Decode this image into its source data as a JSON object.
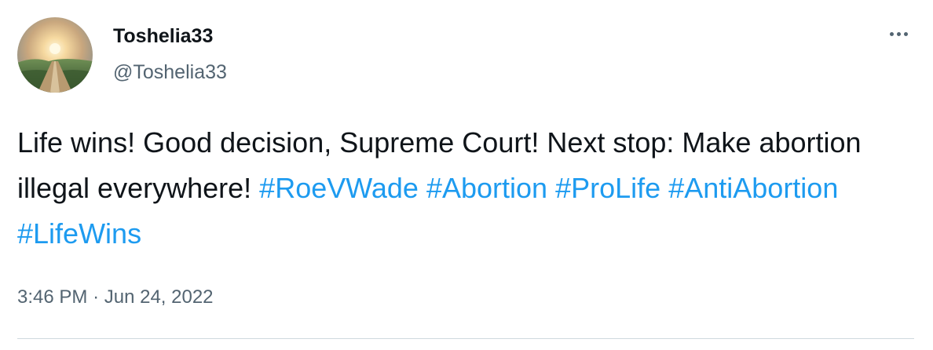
{
  "tweet": {
    "display_name": "Toshelia33",
    "handle": "@Toshelia33",
    "more_icon": "ellipsis-icon",
    "text_plain": "Life wins! Good decision, Supreme Court! Next stop: Make abortion illegal everywhere!",
    "hashtags": [
      "#RoeVWade",
      "#Abortion",
      "#ProLife",
      "#AntiAbortion",
      "#LifeWins"
    ],
    "time": "3:46 PM",
    "separator": "·",
    "date": "Jun 24, 2022"
  },
  "colors": {
    "text": "#0f1419",
    "secondary": "#536471",
    "link": "#1d9bf0",
    "divider": "#cfd9de"
  }
}
